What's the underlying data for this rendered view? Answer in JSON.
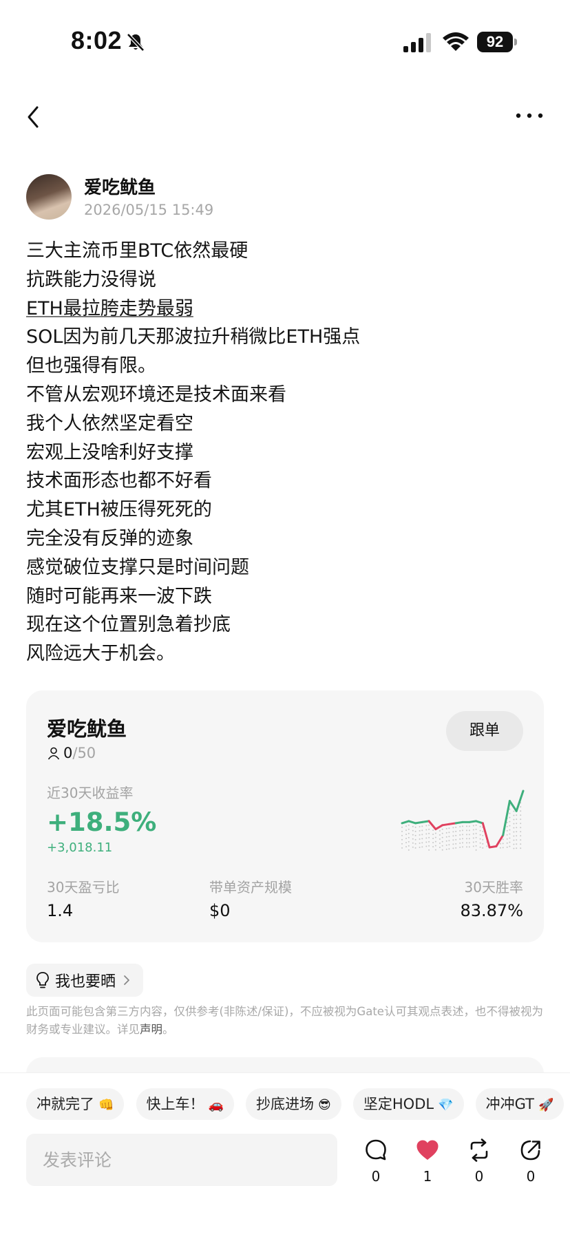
{
  "status_bar": {
    "time": "8:02",
    "battery": "92"
  },
  "post": {
    "author": "爱吃鱿鱼",
    "timestamp": "2026/05/15 15:49",
    "lines": [
      "三大主流币里BTC依然最硬",
      "抗跌能力没得说",
      "ETH最拉胯走势最弱",
      "SOL因为前几天那波拉升稍微比ETH强点",
      "但也强得有限。",
      "不管从宏观环境还是技术面来看",
      "我个人依然坚定看空",
      "宏观上没啥利好支撑",
      "技术面形态也都不好看",
      "尤其ETH被压得死死的",
      "完全没有反弹的迹象",
      "感觉破位支撑只是时间问题",
      "随时可能再来一波下跌",
      "现在这个位置别急着抄底",
      "风险远大于机会。"
    ]
  },
  "trader_card": {
    "name": "爱吃鱿鱼",
    "followers_count": "0",
    "followers_max": "/50",
    "follow_label": "跟单",
    "roi_label": "近30天收益率",
    "roi_value": "+18.5%",
    "roi_amount": "+3,018.11",
    "stats": [
      {
        "label": "30天盈亏比",
        "value": "1.4"
      },
      {
        "label": "带单资产规模",
        "value": "$0"
      },
      {
        "label": "30天胜率",
        "value": "83.87%"
      }
    ],
    "sparkline": {
      "values": [
        14,
        15,
        14,
        14.5,
        15,
        11,
        13,
        13.5,
        14,
        14.5,
        14.5,
        15,
        14,
        2,
        2.5,
        8,
        25,
        20,
        30
      ],
      "colors": {
        "up": "#3eaf7c",
        "down": "#e0415f",
        "dots": "#c9c9c9"
      }
    }
  },
  "share": {
    "label": "我也要晒"
  },
  "disclaimer": {
    "text": "此页面可能包含第三方内容，仅供参考(非陈述/保证)，不应被视为Gate认可其观点表述，也不得被视为财务或专业建议。详见",
    "link": "声明",
    "end": "。"
  },
  "quick_replies": [
    {
      "text": "冲就完了",
      "emoji": "👊"
    },
    {
      "text": "快上车！",
      "emoji": "🚗"
    },
    {
      "text": "抄底进场",
      "emoji": "😎"
    },
    {
      "text": "坚定HODL",
      "emoji": "💎"
    },
    {
      "text": "冲冲GT",
      "emoji": "🚀"
    }
  ],
  "comment_box": {
    "placeholder": "发表评论"
  },
  "actions": {
    "comment_count": "0",
    "like_count": "1",
    "repost_count": "0",
    "share_count": "0"
  },
  "colors": {
    "green": "#3eaf7c",
    "red": "#e0415f",
    "like": "#e0415f"
  }
}
